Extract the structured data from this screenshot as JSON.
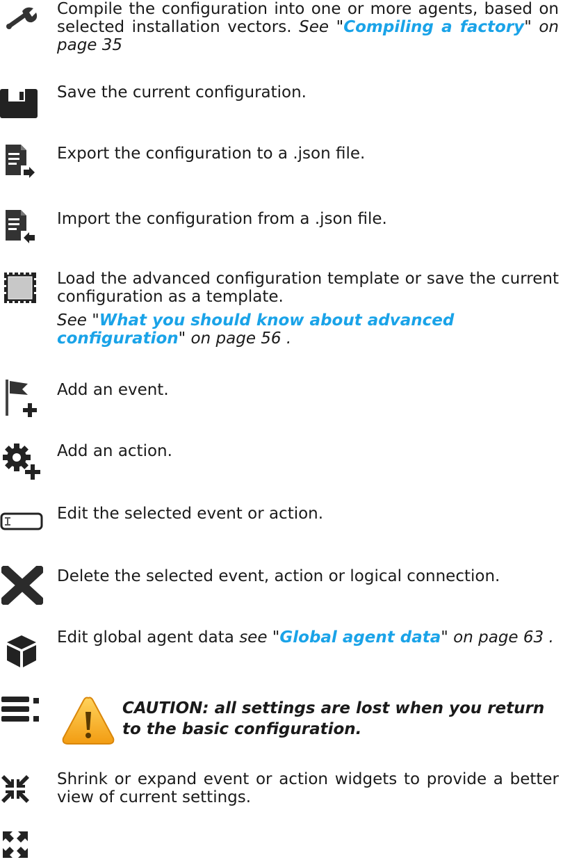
{
  "rows": {
    "compile": {
      "icon": "wrench-icon",
      "text": "Compile the configuration into one or more agents, based on selected installation vectors.",
      "see": "See \"",
      "link": "Compiling a factory",
      "after": "\" on page 35"
    },
    "save": {
      "icon": "floppy-disk-icon",
      "text": "Save the current configuration."
    },
    "export": {
      "icon": "export-file-icon",
      "text": "Export the configuration to a .json file."
    },
    "import": {
      "icon": "import-file-icon",
      "text": "Import the configuration from a .json file."
    },
    "template": {
      "icon": "template-icon",
      "text": "Load the advanced configuration template or save the current configuration as a template.",
      "see": "See \"",
      "link": "What you should know about advanced configuration",
      "after": "\" on page 56 ."
    },
    "add_event": {
      "icon": "add-event-flag-icon",
      "text": "Add an event."
    },
    "add_action": {
      "icon": "add-action-gear-icon",
      "text": "Add an action."
    },
    "edit": {
      "icon": "edit-field-icon",
      "text": "Edit the selected event or action."
    },
    "delete": {
      "icon": "delete-x-icon",
      "text": "Delete the selected event, action or logical connection."
    },
    "global": {
      "icon": "global-data-cube-icon",
      "text": "Edit global agent data",
      "see": "see \"",
      "link": "Global agent data",
      "after": "\" on page 63 ."
    },
    "basic": {
      "icon": "basic-config-menu-icon",
      "warning_icon": "warning-triangle-icon",
      "caution": "CAUTION: all settings are lost when you return to the basic configuration."
    },
    "shrink": {
      "icon": "shrink-icon",
      "expand_icon": "expand-icon",
      "text": "Shrink or expand event or action widgets to provide a better view of current settings."
    }
  },
  "colors": {
    "link": "#1aa3e8",
    "icon": "#2b2b2b",
    "warning": "#f5a623"
  }
}
